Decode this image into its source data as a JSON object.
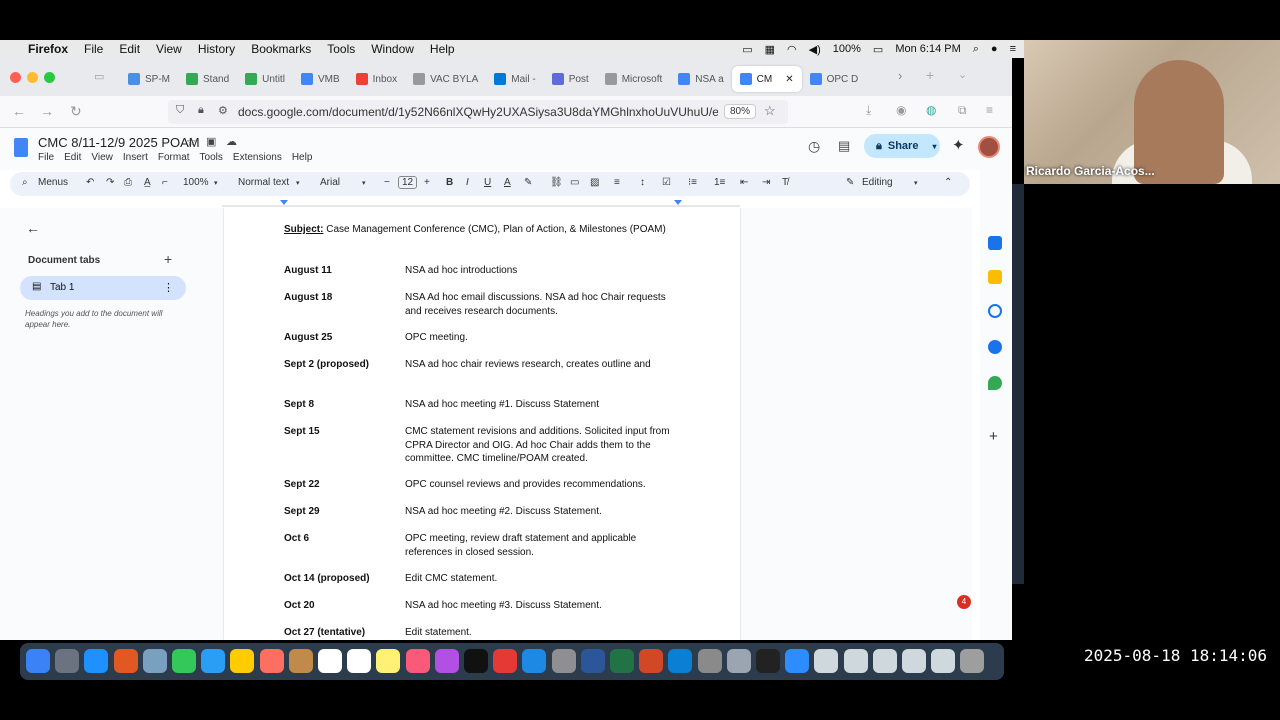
{
  "menubar": {
    "app": "Firefox",
    "items": [
      "File",
      "Edit",
      "View",
      "History",
      "Bookmarks",
      "Tools",
      "Window",
      "Help"
    ],
    "battery": "100%",
    "clock": "Mon 6:14 PM"
  },
  "browser": {
    "tabs": [
      {
        "label": "SP-M",
        "color": "#4a90e2"
      },
      {
        "label": "Stand",
        "color": "#34a853"
      },
      {
        "label": "Untitl",
        "color": "#34a853"
      },
      {
        "label": "VMB",
        "color": "#4285f4"
      },
      {
        "label": "Inbox",
        "color": "#ea4335"
      },
      {
        "label": "VAC BYLA",
        "color": "#999999"
      },
      {
        "label": "Mail -",
        "color": "#0078d4"
      },
      {
        "label": "Post",
        "color": "#5f6bd8"
      },
      {
        "label": "Microsoft",
        "color": "#999999"
      },
      {
        "label": "NSA a",
        "color": "#4285f4"
      },
      {
        "label": "CM",
        "color": "#4285f4",
        "active": true
      },
      {
        "label": "OPC D",
        "color": "#4285f4"
      }
    ],
    "url": "docs.google.com/document/d/1y52N66nlXQwHy2UXASiysa3U8daYMGhlnxhoUuVUhuU/edit?",
    "zoom": "80%"
  },
  "docs": {
    "title": "CMC 8/11-12/9 2025 POAM",
    "menus": [
      "File",
      "Edit",
      "View",
      "Insert",
      "Format",
      "Tools",
      "Extensions",
      "Help"
    ],
    "share_label": "Share",
    "toolbar": {
      "menus": "Menus",
      "zoom": "100%",
      "style": "Normal text",
      "font": "Arial",
      "size": "12",
      "mode": "Editing"
    },
    "sidebar": {
      "heading": "Document tabs",
      "tab_label": "Tab 1",
      "hint": "Headings you add to the document will appear here."
    },
    "subject_label": "Subject:",
    "subject_text": "Case Management Conference (CMC), Plan of Action, & Milestones (POAM)",
    "rows": [
      {
        "date": "August 11",
        "desc": "NSA ad hoc introductions"
      },
      {
        "date": "August 18",
        "desc": "NSA Ad hoc email discussions. NSA ad hoc Chair requests and receives research documents."
      },
      {
        "date": "August 25",
        "desc": "OPC meeting."
      },
      {
        "date": "Sept 2 (proposed)",
        "desc": "NSA ad hoc chair reviews research, creates outline and"
      },
      {
        "date": "Sept 8",
        "desc": "NSA ad hoc meeting #1. Discuss Statement"
      },
      {
        "date": "Sept 15",
        "desc": "CMC statement revisions and additions. Solicited input from CPRA Director and OIG. Ad hoc Chair adds them to the committee. CMC timeline/POAM created."
      },
      {
        "date": "Sept 22",
        "desc": "OPC counsel reviews and provides recommendations."
      },
      {
        "date": "Sept 29",
        "desc": "NSA ad hoc meeting #2. Discuss Statement."
      },
      {
        "date": "Oct 6",
        "desc": "OPC meeting, review draft statement and applicable references in closed session."
      },
      {
        "date": "Oct 14 (proposed)",
        "desc": "Edit CMC statement."
      },
      {
        "date": "Oct 20",
        "desc": "NSA ad hoc meeting #3. Discuss Statement."
      },
      {
        "date": "Oct 27 (tentative)",
        "desc": "Edit statement."
      }
    ],
    "notification_count": "4"
  },
  "webcam": {
    "name": "Ricardo Garcia-Acos..."
  },
  "timestamp": "2025-08-18  18:14:06"
}
